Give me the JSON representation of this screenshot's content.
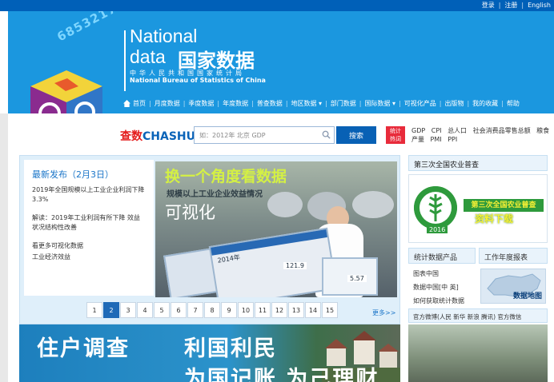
{
  "top_links": [
    "登录",
    "注册",
    "English"
  ],
  "brand": {
    "digits": "6 8 5 3 2 1 7",
    "line1": "National",
    "line2": "data",
    "cn": "国家数据",
    "sub_cn": "中华人民共和国国家统计局",
    "sub_en": "National Bureau of Statistics of China"
  },
  "nav": {
    "items": [
      "首页",
      "月度数据",
      "季度数据",
      "年度数据",
      "普查数据",
      "地区数据 ▾",
      "部门数据",
      "国际数据 ▾",
      "可视化产品",
      "出版物",
      "我的收藏",
      "帮助"
    ]
  },
  "search": {
    "logo_a": "查数",
    "logo_b": "CHASHU",
    "placeholder": "如：2012年 北京 GDP",
    "button": "搜索",
    "hot_badge_1": "统计",
    "hot_badge_2": "热词",
    "hot_terms": [
      "GDP",
      "CPI",
      "总人口",
      "社会消费品零售总额",
      "粮食产量",
      "PMI",
      "PPI"
    ]
  },
  "news": {
    "title": "最新发布（2月3日）",
    "items": [
      "2019年全国规模以上工业企业利润下降3.3%",
      "解读：2019年工业利润有所下降 效益状况结构性改善",
      "看更多可视化数据",
      "工业经济效益"
    ]
  },
  "slide": {
    "headline": "换一个角度看数据",
    "subhead": "规模以上工业企业效益情况",
    "tag": "可视化",
    "year": "2014年",
    "num1": "121.9",
    "num2": "5.57"
  },
  "pager": {
    "pages": [
      "1",
      "2",
      "3",
      "4",
      "5",
      "6",
      "7",
      "8",
      "9",
      "10",
      "11",
      "12",
      "13",
      "14",
      "15"
    ],
    "active_index": 1,
    "more": "更多>>"
  },
  "bottom_banner": {
    "line1": "住户调查",
    "line2": "利国利民",
    "line3": "为国记账  为己理财"
  },
  "right": {
    "census_head": "第三次全国农业普查",
    "census_title": "第三次全国农业普查",
    "census_download": "资料下载",
    "census_year": "2016",
    "tab_products": "统计数据产品",
    "tab_annual": "工作年度报表",
    "product_links": [
      "图表中国",
      "数据中国[中 英]",
      "如何获取统计数据"
    ],
    "map_label": "数据地图",
    "weibo": "官方微博(人民 新华 新浪 腾讯) 官方微信"
  },
  "colors": {
    "banner_blue": "#1b97df",
    "topbar_blue": "#0060b8",
    "link_blue": "#1a75c8",
    "button_blue": "#0861b5",
    "hot_red": "#e82b3b",
    "census_green": "#2e9a3c"
  }
}
